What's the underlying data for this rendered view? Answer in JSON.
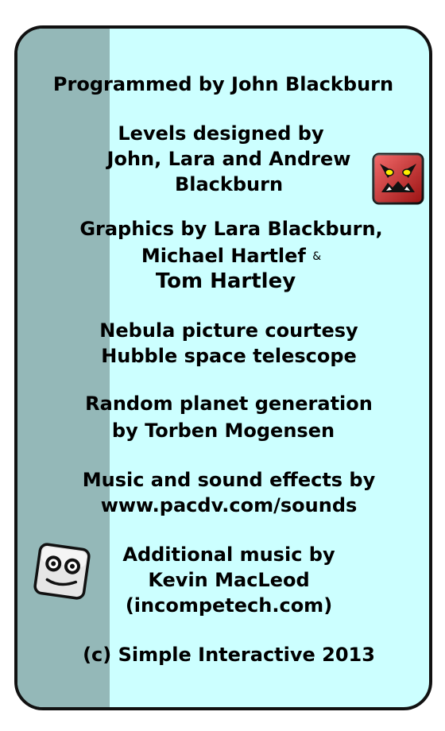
{
  "credits": {
    "programmed": "Programmed by John Blackburn",
    "levels_l1": "Levels designed by",
    "levels_l2": "John, Lara and Andrew",
    "levels_l3": "Blackburn",
    "graphics_l1": "Graphics by Lara Blackburn,",
    "graphics_l2": "Michael Hartlef",
    "graphics_amp": "&",
    "graphics_l3": "Tom Hartley",
    "nebula_l1": "Nebula picture courtesy",
    "nebula_l2": "Hubble space telescope",
    "planet_l1": "Random planet generation",
    "planet_l2": "by Torben Mogensen",
    "music_l1": "Music and sound effects by",
    "music_l2": "www.pacdv.com/sounds",
    "addl_l1": "Additional music by",
    "addl_l2": "Kevin MacLeod",
    "addl_l3": "(incompetech.com)",
    "copyright": "(c) Simple Interactive 2013"
  },
  "icons": {
    "red_face": "angry-red-face-icon",
    "grey_face": "smiling-grey-robot-face-icon"
  },
  "colors": {
    "card_background": "#ccffff",
    "left_stripe": "#94b8b8",
    "border": "#111111",
    "red_face_fill": "#ee1c1c",
    "red_face_eyes": "#ffee00",
    "grey_face_fill": "#e6e6e6"
  }
}
